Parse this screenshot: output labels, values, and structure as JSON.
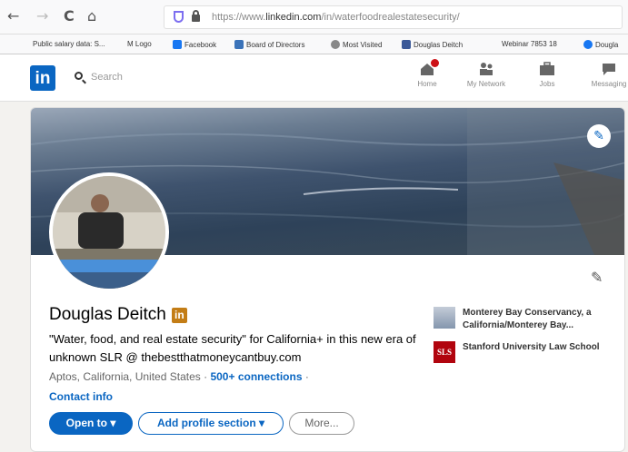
{
  "browser": {
    "back": "←",
    "forward": "→",
    "reload": "C",
    "home": "⌂",
    "url_prefix": "https://www.",
    "url_domain": "linkedin.com",
    "url_path": "/in/waterfoodrealestatesecurity/"
  },
  "bookmarks": [
    {
      "label": "Public salary data: S...",
      "color": "#d0d0d0"
    },
    {
      "label": "M Logo",
      "color": "#ffffff"
    },
    {
      "label": "Facebook",
      "color": "#1877f2"
    },
    {
      "label": "Board of Directors",
      "color": "#3b73b9"
    },
    {
      "label": "Most Visited",
      "color": "#888888"
    },
    {
      "label": "Douglas Deitch",
      "color": "#3b5998"
    },
    {
      "label": "Webinar 7853 18",
      "color": "#ffffff"
    },
    {
      "label": "Dougla",
      "color": "#1877f2"
    }
  ],
  "linkedin_nav": {
    "logo": "in",
    "search_placeholder": "Search",
    "items": [
      "Home",
      "My Network",
      "Jobs",
      "Messaging"
    ]
  },
  "profile": {
    "name": "Douglas Deitch",
    "badge": "in",
    "headline": "\"Water, food, and real estate security\" for California+ in this new era of unknown SLR @ thebestthatmoneycantbuy.com",
    "location": "Aptos, California, United States",
    "separator": "·",
    "connections": "500+ connections",
    "contact_info": "Contact info",
    "buttons": {
      "open_to": "Open to ▾",
      "add_section": "Add profile section ▾",
      "more": "More..."
    }
  },
  "sidebar": [
    {
      "text": "Monterey Bay Conservancy, a California/Monterey Bay..."
    },
    {
      "text": "Stanford University Law School",
      "logo_text": "SLS"
    }
  ],
  "colors": {
    "accent": "#0a66c2",
    "badge": "#c37d16",
    "stanford": "#b1040e"
  }
}
